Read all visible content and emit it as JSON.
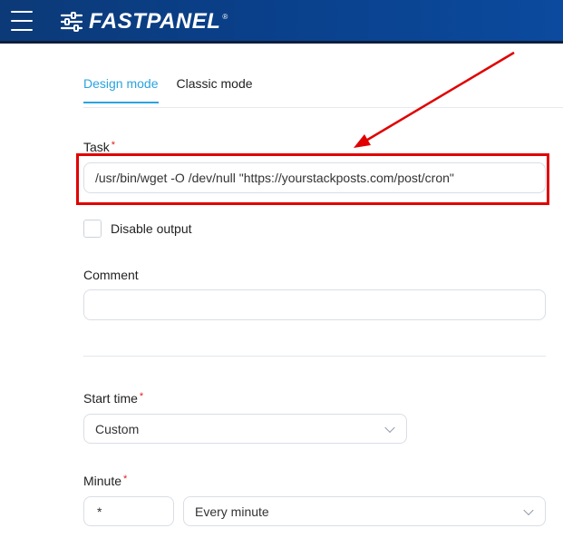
{
  "header": {
    "logo_text": "FASTPANEL",
    "logo_mark": "®"
  },
  "tabs": [
    {
      "label": "Design mode",
      "active": true
    },
    {
      "label": "Classic mode",
      "active": false
    }
  ],
  "task": {
    "label": "Task",
    "required": "*",
    "value": "/usr/bin/wget -O /dev/null \"https://yourstackposts.com/post/cron\""
  },
  "disable_output": {
    "label": "Disable output",
    "checked": false
  },
  "comment": {
    "label": "Comment",
    "value": ""
  },
  "start_time": {
    "label": "Start time",
    "required": "*",
    "value": "Custom"
  },
  "minute": {
    "label": "Minute",
    "required": "*",
    "value": "*",
    "select_value": "Every minute"
  },
  "colors": {
    "accent": "#2aa3e0",
    "header": "#0a3f88",
    "highlight": "#e00000"
  }
}
